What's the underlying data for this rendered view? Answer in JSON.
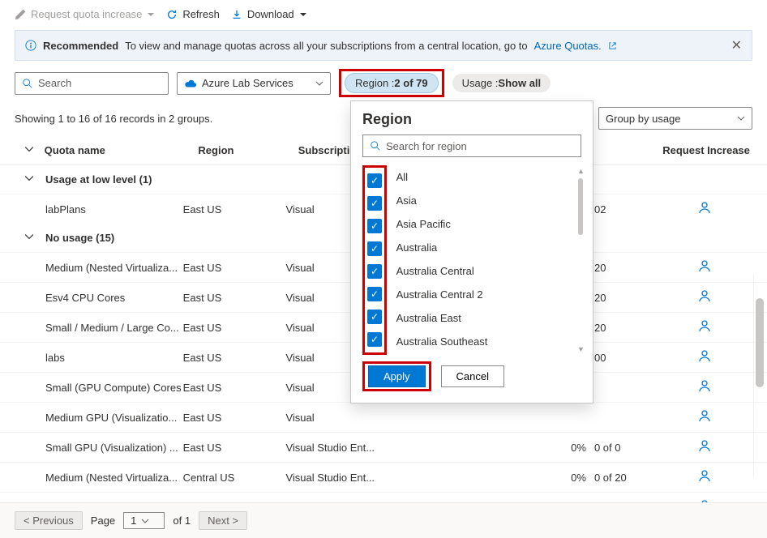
{
  "toolbar": {
    "request_label": "Request quota increase",
    "refresh_label": "Refresh",
    "download_label": "Download"
  },
  "recommendation": {
    "label": "Recommended",
    "text": "To view and manage quotas across all your subscriptions from a central location, go to ",
    "link": "Azure Quotas."
  },
  "filters": {
    "search_placeholder": "Search",
    "service_name": "Azure Lab Services",
    "region_filter_prefix": "Region : ",
    "region_filter_value": "2 of 79",
    "usage_prefix": "Usage : ",
    "usage_value": "Show all"
  },
  "status": {
    "showing": "Showing 1 to 16 of 16 records in 2 groups.",
    "groupby": "Group by usage"
  },
  "columns": {
    "name": "Quota name",
    "region": "Region",
    "sub": "Subscription",
    "request": "Request Increase"
  },
  "groups": [
    {
      "h": "Usage at low level (1)",
      "rows": [
        {
          "name": "labPlans",
          "region": "East US",
          "sub": "Visual",
          "pct": "",
          "usage": "02"
        }
      ]
    },
    {
      "h": "No usage (15)",
      "rows": [
        {
          "name": "Medium (Nested Virtualiza...",
          "region": "East US",
          "sub": "Visual",
          "pct": "",
          "usage": "20"
        },
        {
          "name": "Esv4 CPU Cores",
          "region": "East US",
          "sub": "Visual",
          "pct": "",
          "usage": "20"
        },
        {
          "name": "Small / Medium / Large Co...",
          "region": "East US",
          "sub": "Visual",
          "pct": "",
          "usage": "20"
        },
        {
          "name": "labs",
          "region": "East US",
          "sub": "Visual",
          "pct": "",
          "usage": "00"
        },
        {
          "name": "Small (GPU Compute) Cores",
          "region": "East US",
          "sub": "Visual",
          "pct": "",
          "usage": ""
        },
        {
          "name": "Medium GPU (Visualizatio...",
          "region": "East US",
          "sub": "Visual",
          "pct": "",
          "usage": ""
        },
        {
          "name": "Small GPU (Visualization) ...",
          "region": "East US",
          "sub": "Visual Studio Ent...",
          "pct": "0%",
          "usage": "0 of 0"
        },
        {
          "name": "Medium (Nested Virtualiza...",
          "region": "Central US",
          "sub": "Visual Studio Ent...",
          "pct": "0%",
          "usage": "0 of 20"
        },
        {
          "name": "Esv4 CPU Cores",
          "region": "Central US",
          "sub": "Visual Studio Ent...",
          "pct": "0%",
          "usage": "0 of 20"
        }
      ]
    }
  ],
  "footer": {
    "previous": "< Previous",
    "page_label": "Page",
    "page_current": "1",
    "of": "of 1",
    "next": "Next >"
  },
  "popup": {
    "title": "Region",
    "search_placeholder": "Search for region",
    "items": [
      {
        "label": "All"
      },
      {
        "label": "Asia"
      },
      {
        "label": "Asia Pacific"
      },
      {
        "label": "Australia"
      },
      {
        "label": "Australia Central"
      },
      {
        "label": "Australia Central 2"
      },
      {
        "label": "Australia East"
      },
      {
        "label": "Australia Southeast"
      }
    ],
    "apply": "Apply",
    "cancel": "Cancel"
  }
}
